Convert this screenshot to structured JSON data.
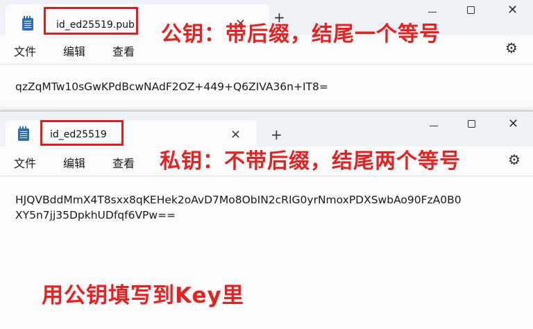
{
  "windows": [
    {
      "tab_title": "id_ed25519.pub",
      "menu": [
        "文件",
        "编辑",
        "查看"
      ],
      "content_lines": [
        "qzZqMTw10sGwKPdBcwNAdF2OZ+449+Q6ZIVA36n+IT8="
      ]
    },
    {
      "tab_title": "id_ed25519",
      "menu": [
        "文件",
        "编辑",
        "查看"
      ],
      "content_lines": [
        "HJQVBddMmX4T8sxx8qKEHek2oAvD7Mo8ObIN2cRIG0yrNmoxPDXSwbAo90FzA0B0",
        "XY5n7jj35DpkhUDfqf6VPw=="
      ]
    }
  ],
  "annotations": {
    "public_key": "公钥：带后缀，结尾一个等号",
    "private_key": "私钥：不带后缀，结尾两个等号",
    "instruction": "用公钥填写到Key里"
  },
  "icons": {
    "app": "notepad-icon",
    "close": "×",
    "new_tab": "+",
    "window_close": "✕",
    "gear": "⚙"
  },
  "colors": {
    "annotation": "#e82020",
    "highlight_box": "#e31b1b",
    "titlebar": "#eef2f7"
  }
}
